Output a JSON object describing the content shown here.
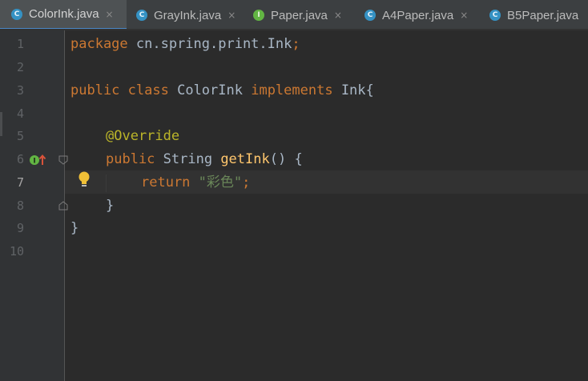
{
  "tabs": [
    {
      "label": "ColorInk.java",
      "icon": "class-icon",
      "letter": "C",
      "close": "×",
      "active": true
    },
    {
      "label": "GrayInk.java",
      "icon": "class-icon",
      "letter": "C",
      "close": "×",
      "active": false
    },
    {
      "label": "Paper.java",
      "icon": "interface-icon",
      "letter": "I",
      "close": "×",
      "active": false
    },
    {
      "label": "A4Paper.java",
      "icon": "class-icon",
      "letter": "C",
      "close": "×",
      "active": false
    },
    {
      "label": "B5Paper.java",
      "icon": "class-icon",
      "letter": "C",
      "close": "",
      "active": false
    }
  ],
  "editor": {
    "line_numbers": [
      "1",
      "2",
      "3",
      "4",
      "5",
      "6",
      "7",
      "8",
      "9",
      "10"
    ],
    "current_line": "7",
    "lines": {
      "l1": {
        "kw": "package",
        "rest": " cn.spring.print.Ink",
        "semi": ";"
      },
      "l3": {
        "kw1": "public",
        "kw2": "class",
        "name": " ColorInk ",
        "kw3": "implements",
        "rest": " Ink{"
      },
      "l5": {
        "ann": "@Override"
      },
      "l6": {
        "kw": "public",
        "type": " String ",
        "fn": "getInk",
        "rest": "() {"
      },
      "l7": {
        "kw": "return",
        "str": "\"彩色\"",
        "semi": ";"
      },
      "l8": {
        "text": "}"
      },
      "l9": {
        "text": "}"
      }
    },
    "gutter_icons": {
      "implements_marker": "implements-method-icon",
      "fold_markers": "fold-icon",
      "intention": "lightbulb-icon"
    },
    "colors": {
      "background": "#2b2b2b",
      "keyword": "#cc7832",
      "annotation": "#bbb529",
      "method": "#ffc66d",
      "string": "#6a8759",
      "text": "#a9b7c6"
    }
  }
}
